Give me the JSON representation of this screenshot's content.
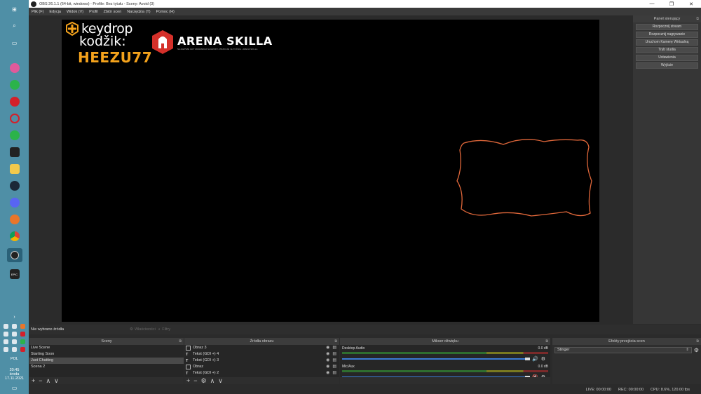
{
  "taskbar": {
    "clock_time": "20:45",
    "clock_day": "środa",
    "clock_date": "17.11.2021",
    "lang": "POL"
  },
  "window": {
    "title": "OBS 26.1.1 (64-bit, windows) - Profile: Bez tytułu - Sceny: Avoid (3)",
    "controls": [
      "—",
      "❐",
      "✕"
    ]
  },
  "menu": [
    "Plik (F)",
    "Edycja",
    "Widok (V)",
    "Profil",
    "Zbiór scen",
    "Narzędzia (T)",
    "Pomoc (H)"
  ],
  "preview": {
    "keydrop_brand": "keydrop",
    "keydrop_label": "kodžik:",
    "keydrop_code": "HEEZU77",
    "arena_title": "ARENA SKILLA",
    "arena_sub": "NAJLEPSZE GRY ZDARZENIA NAGRODY ATRAKCJE I E-TOČNIA - ARENA SKILLA",
    "frame_color": "#e0673a"
  },
  "control_panel": {
    "title": "Panel sterujący",
    "buttons": [
      "Rozpocznij stream",
      "Rozpocznij nagrywanie",
      "Uruchom Kamerę Wirtualną",
      "Tryb studia",
      "Ustawienia",
      "Wyjście"
    ]
  },
  "source_bar": {
    "no_selection": "Nie wybrano źródła",
    "properties": "Właściwości",
    "filters": "Filtry"
  },
  "scenes": {
    "title": "Sceny",
    "items": [
      "Live Scene",
      "Starting Soon",
      "Just Chatting",
      "Scena 2"
    ]
  },
  "sources": {
    "title": "Źródła obrazu",
    "items": [
      "Obraz 3",
      "Tekst (GDI +) 4",
      "Tekst (GDI +) 3",
      "Obraz",
      "Tekst (GDI +) 2"
    ]
  },
  "mixer": {
    "title": "Mikser dźwięku",
    "channels": [
      {
        "name": "Desktop Audio",
        "db": "0.0 dB"
      },
      {
        "name": "Mic/Aux",
        "db": "0.0 dB"
      }
    ]
  },
  "transitions": {
    "title": "Efekty przejścia scen",
    "selected": "Stinger"
  },
  "status": {
    "live": "LIVE: 00:00:00",
    "rec": "REC: 00:00:00",
    "cpu": "CPU: 8.6%, 120.00 fps"
  }
}
